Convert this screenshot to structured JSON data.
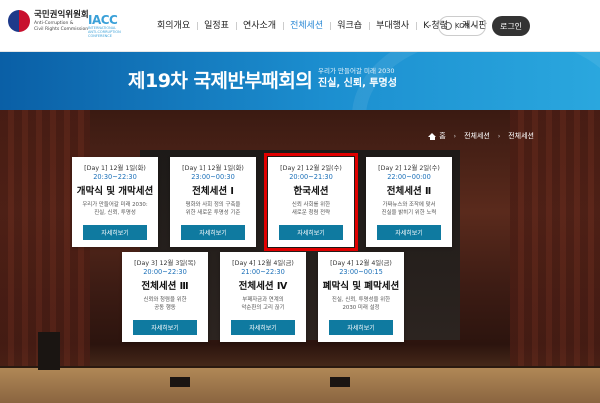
{
  "header": {
    "logo_kr": "국민권익위원회",
    "logo_en_1": "Anti-Corruption &",
    "logo_en_2": "Civil Rights Commission",
    "iacc_mark": "IACC",
    "iacc_sub_1": "INTERNATIONAL",
    "iacc_sub_2": "ANTI-CORRUPTION",
    "iacc_sub_3": "CONFERENCE",
    "nav": [
      "회의개요",
      "일정표",
      "연사소개",
      "전체세션",
      "워크숍",
      "부대행사",
      "K-청렴",
      "게시판"
    ],
    "active_nav": "전체세션",
    "lang": "KOR",
    "login": "로그인"
  },
  "banner": {
    "title": "제19차 국제반부패회의",
    "sub": "우리가 만들어갈 미래 2030",
    "sub2": "진실, 신뢰, 투명성"
  },
  "breadcrumb": {
    "home": "홈",
    "level1": "전체세션",
    "level2": "전체세션"
  },
  "cards": [
    {
      "date": "[Day 1] 12월 1일(화)",
      "time": "20:30~22:30",
      "title": "개막식 및 개막세션",
      "desc": "우리가 만들어갈 미래 2030:\n진실, 신뢰, 투명성",
      "btn": "자세히보기"
    },
    {
      "date": "[Day 1] 12월 1일(화)",
      "time": "23:00~00:30",
      "title": "전체세션 Ⅰ",
      "desc": "평화와 사회 정의 구축을\n위한 새로운 투명성 기준",
      "btn": "자세히보기"
    },
    {
      "date": "[Day 2] 12월 2일(수)",
      "time": "20:00~21:30",
      "title": "한국세션",
      "desc": "신뢰 사회를 위한\n새로운 청렴 전략",
      "btn": "자세히보기"
    },
    {
      "date": "[Day 2] 12월 2일(수)",
      "time": "22:00~00:00",
      "title": "전체세션 Ⅱ",
      "desc": "가짜뉴스와 조작에 맞서\n진실을 밝히기 위한 노력",
      "btn": "자세히보기"
    },
    {
      "date": "[Day 3] 12월 3일(목)",
      "time": "20:00~22:30",
      "title": "전체세션 Ⅲ",
      "desc": "신뢰와 청렴을 위한\n공동 행동",
      "btn": "자세히보기"
    },
    {
      "date": "[Day 4] 12월 4일(금)",
      "time": "21:00~22:30",
      "title": "전체세션 Ⅳ",
      "desc": "부패자금과 연계의\n악순환의 고리 끊기",
      "btn": "자세히보기"
    },
    {
      "date": "[Day 4] 12월 4일(금)",
      "time": "23:00~00:15",
      "title": "폐막식 및 폐막세션",
      "desc": "진실, 신뢰, 투명성을 위한\n2030 미래 설정",
      "btn": "자세히보기"
    }
  ]
}
